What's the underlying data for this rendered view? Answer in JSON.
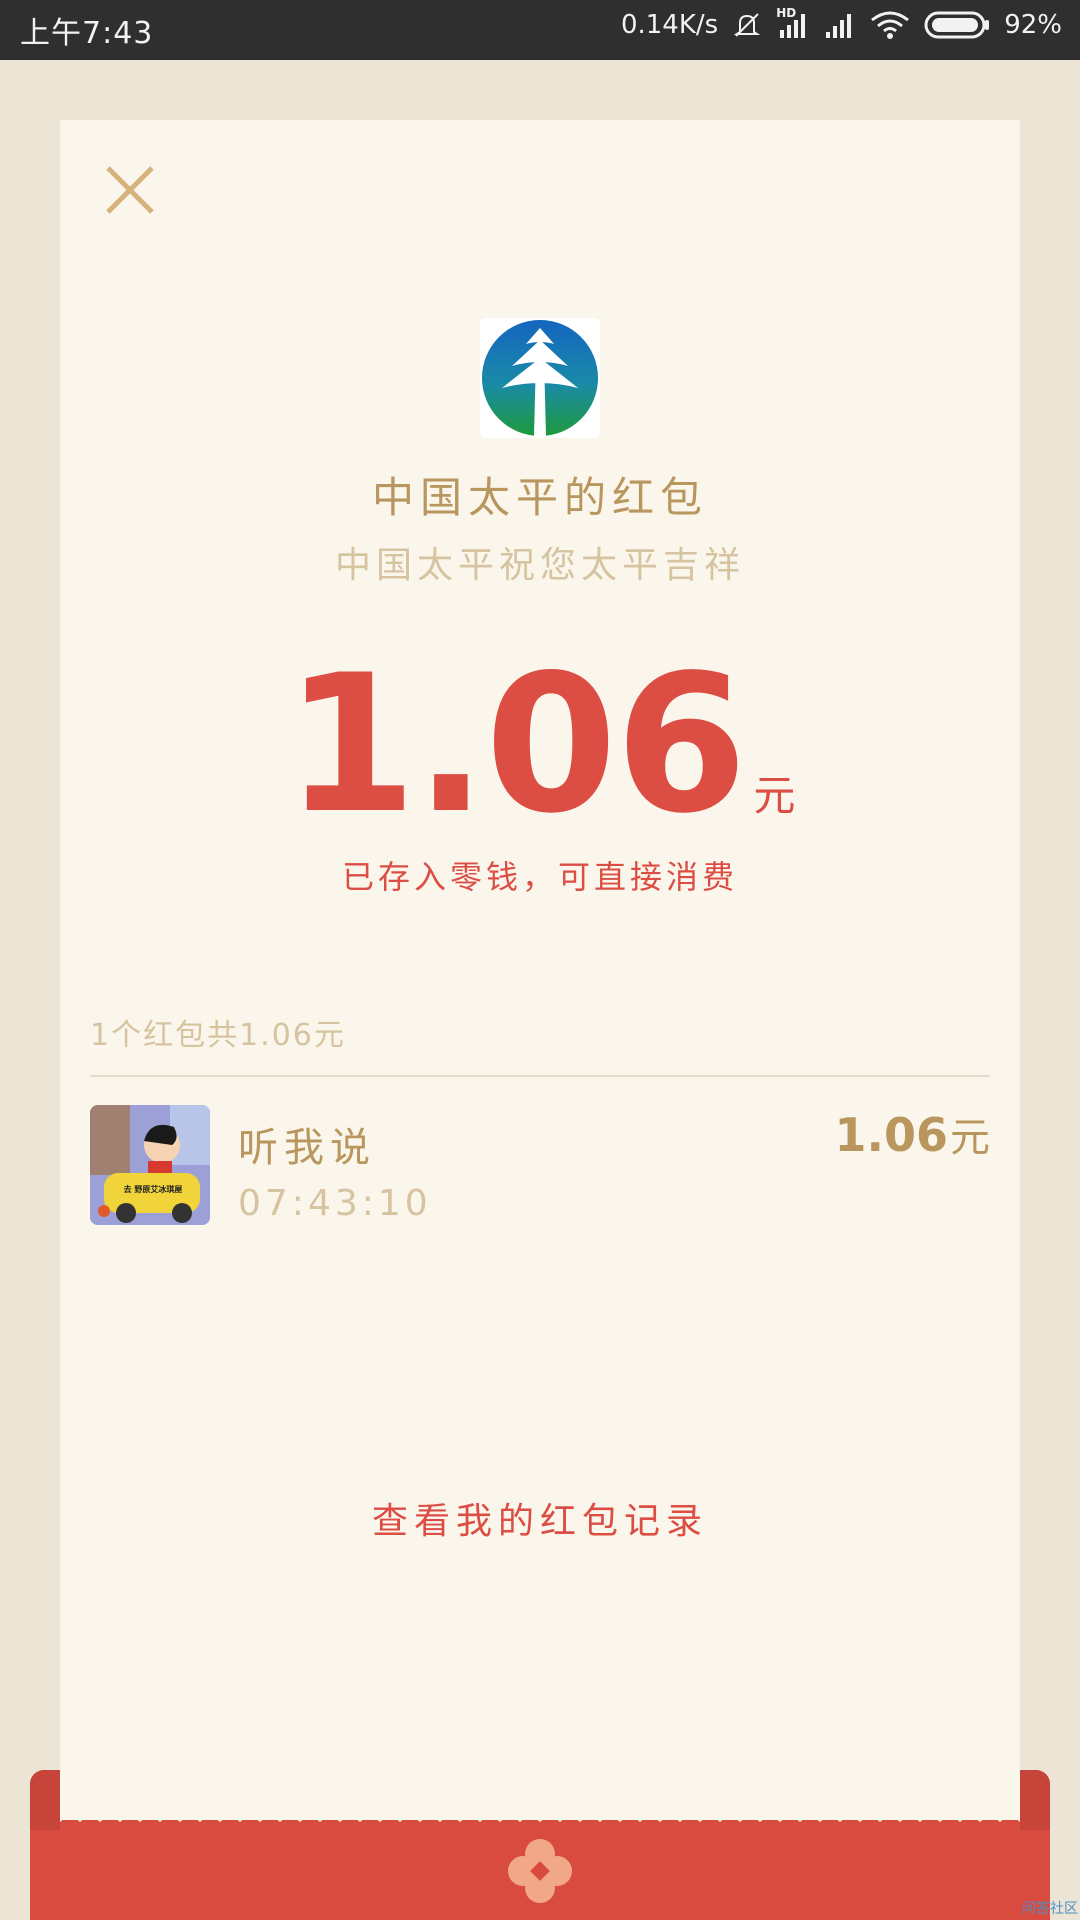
{
  "status_bar": {
    "time": "上午7:43",
    "net_speed": "0.14K/s",
    "hd": "HD",
    "battery": "92%"
  },
  "redpacket": {
    "sender_title": "中国太平的红包",
    "greeting": "中国太平祝您太平吉祥",
    "amount": "1.06",
    "unit": "元",
    "deposit_note": "已存入零钱，可直接消费",
    "summary": "1个红包共1.06元",
    "records": [
      {
        "name": "听我说",
        "time": "07:43:10",
        "amount": "1.06",
        "unit": "元",
        "avatar_caption": "去 野原艾冰琪屋"
      }
    ],
    "history_link": "查看我的红包记录"
  },
  "watermark": "问答社区",
  "icons": {
    "close": "close-icon",
    "logo": "china-taiping-logo",
    "envelope_emblem": "flower-emblem-icon"
  },
  "colors": {
    "accent_red": "#dc4d44",
    "gold": "#b9965d",
    "light_gold": "#d6c4a0",
    "card_bg": "#faf6ec"
  }
}
